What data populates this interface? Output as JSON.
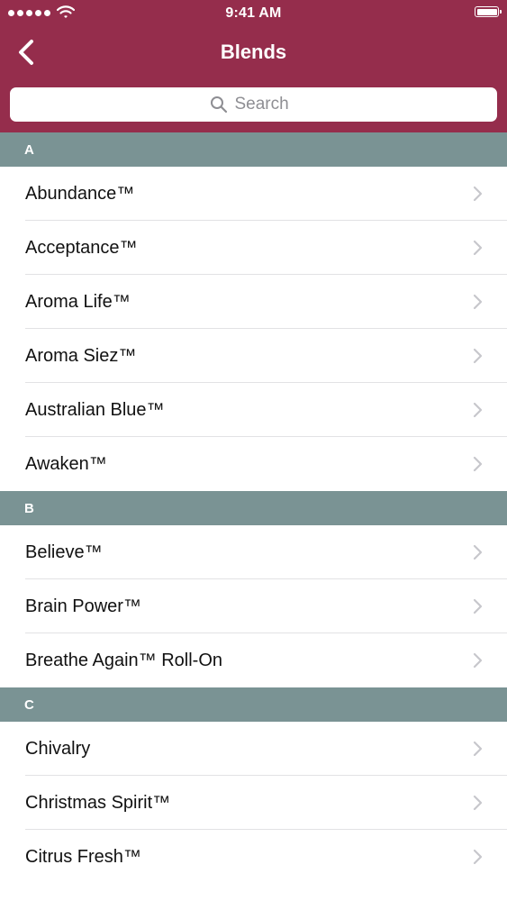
{
  "status_bar": {
    "time": "9:41 AM",
    "icons": [
      "signal-dots-icon",
      "wifi-icon",
      "battery-icon"
    ]
  },
  "nav": {
    "title": "Blends",
    "back_icon": "chevron-left-icon"
  },
  "search": {
    "placeholder": "Search",
    "icon": "search-icon"
  },
  "colors": {
    "header_background": "#952d4c",
    "section_header_background": "#7a9394",
    "chevron": "#c7c7cc"
  },
  "sections": [
    {
      "letter": "A",
      "items": [
        "Abundance™",
        "Acceptance™",
        "Aroma Life™",
        "Aroma Siez™",
        "Australian Blue™",
        "Awaken™"
      ]
    },
    {
      "letter": "B",
      "items": [
        "Believe™",
        "Brain Power™",
        "Breathe Again™ Roll-On"
      ]
    },
    {
      "letter": "C",
      "items": [
        "Chivalry",
        "Christmas Spirit™",
        "Citrus Fresh™"
      ]
    }
  ]
}
